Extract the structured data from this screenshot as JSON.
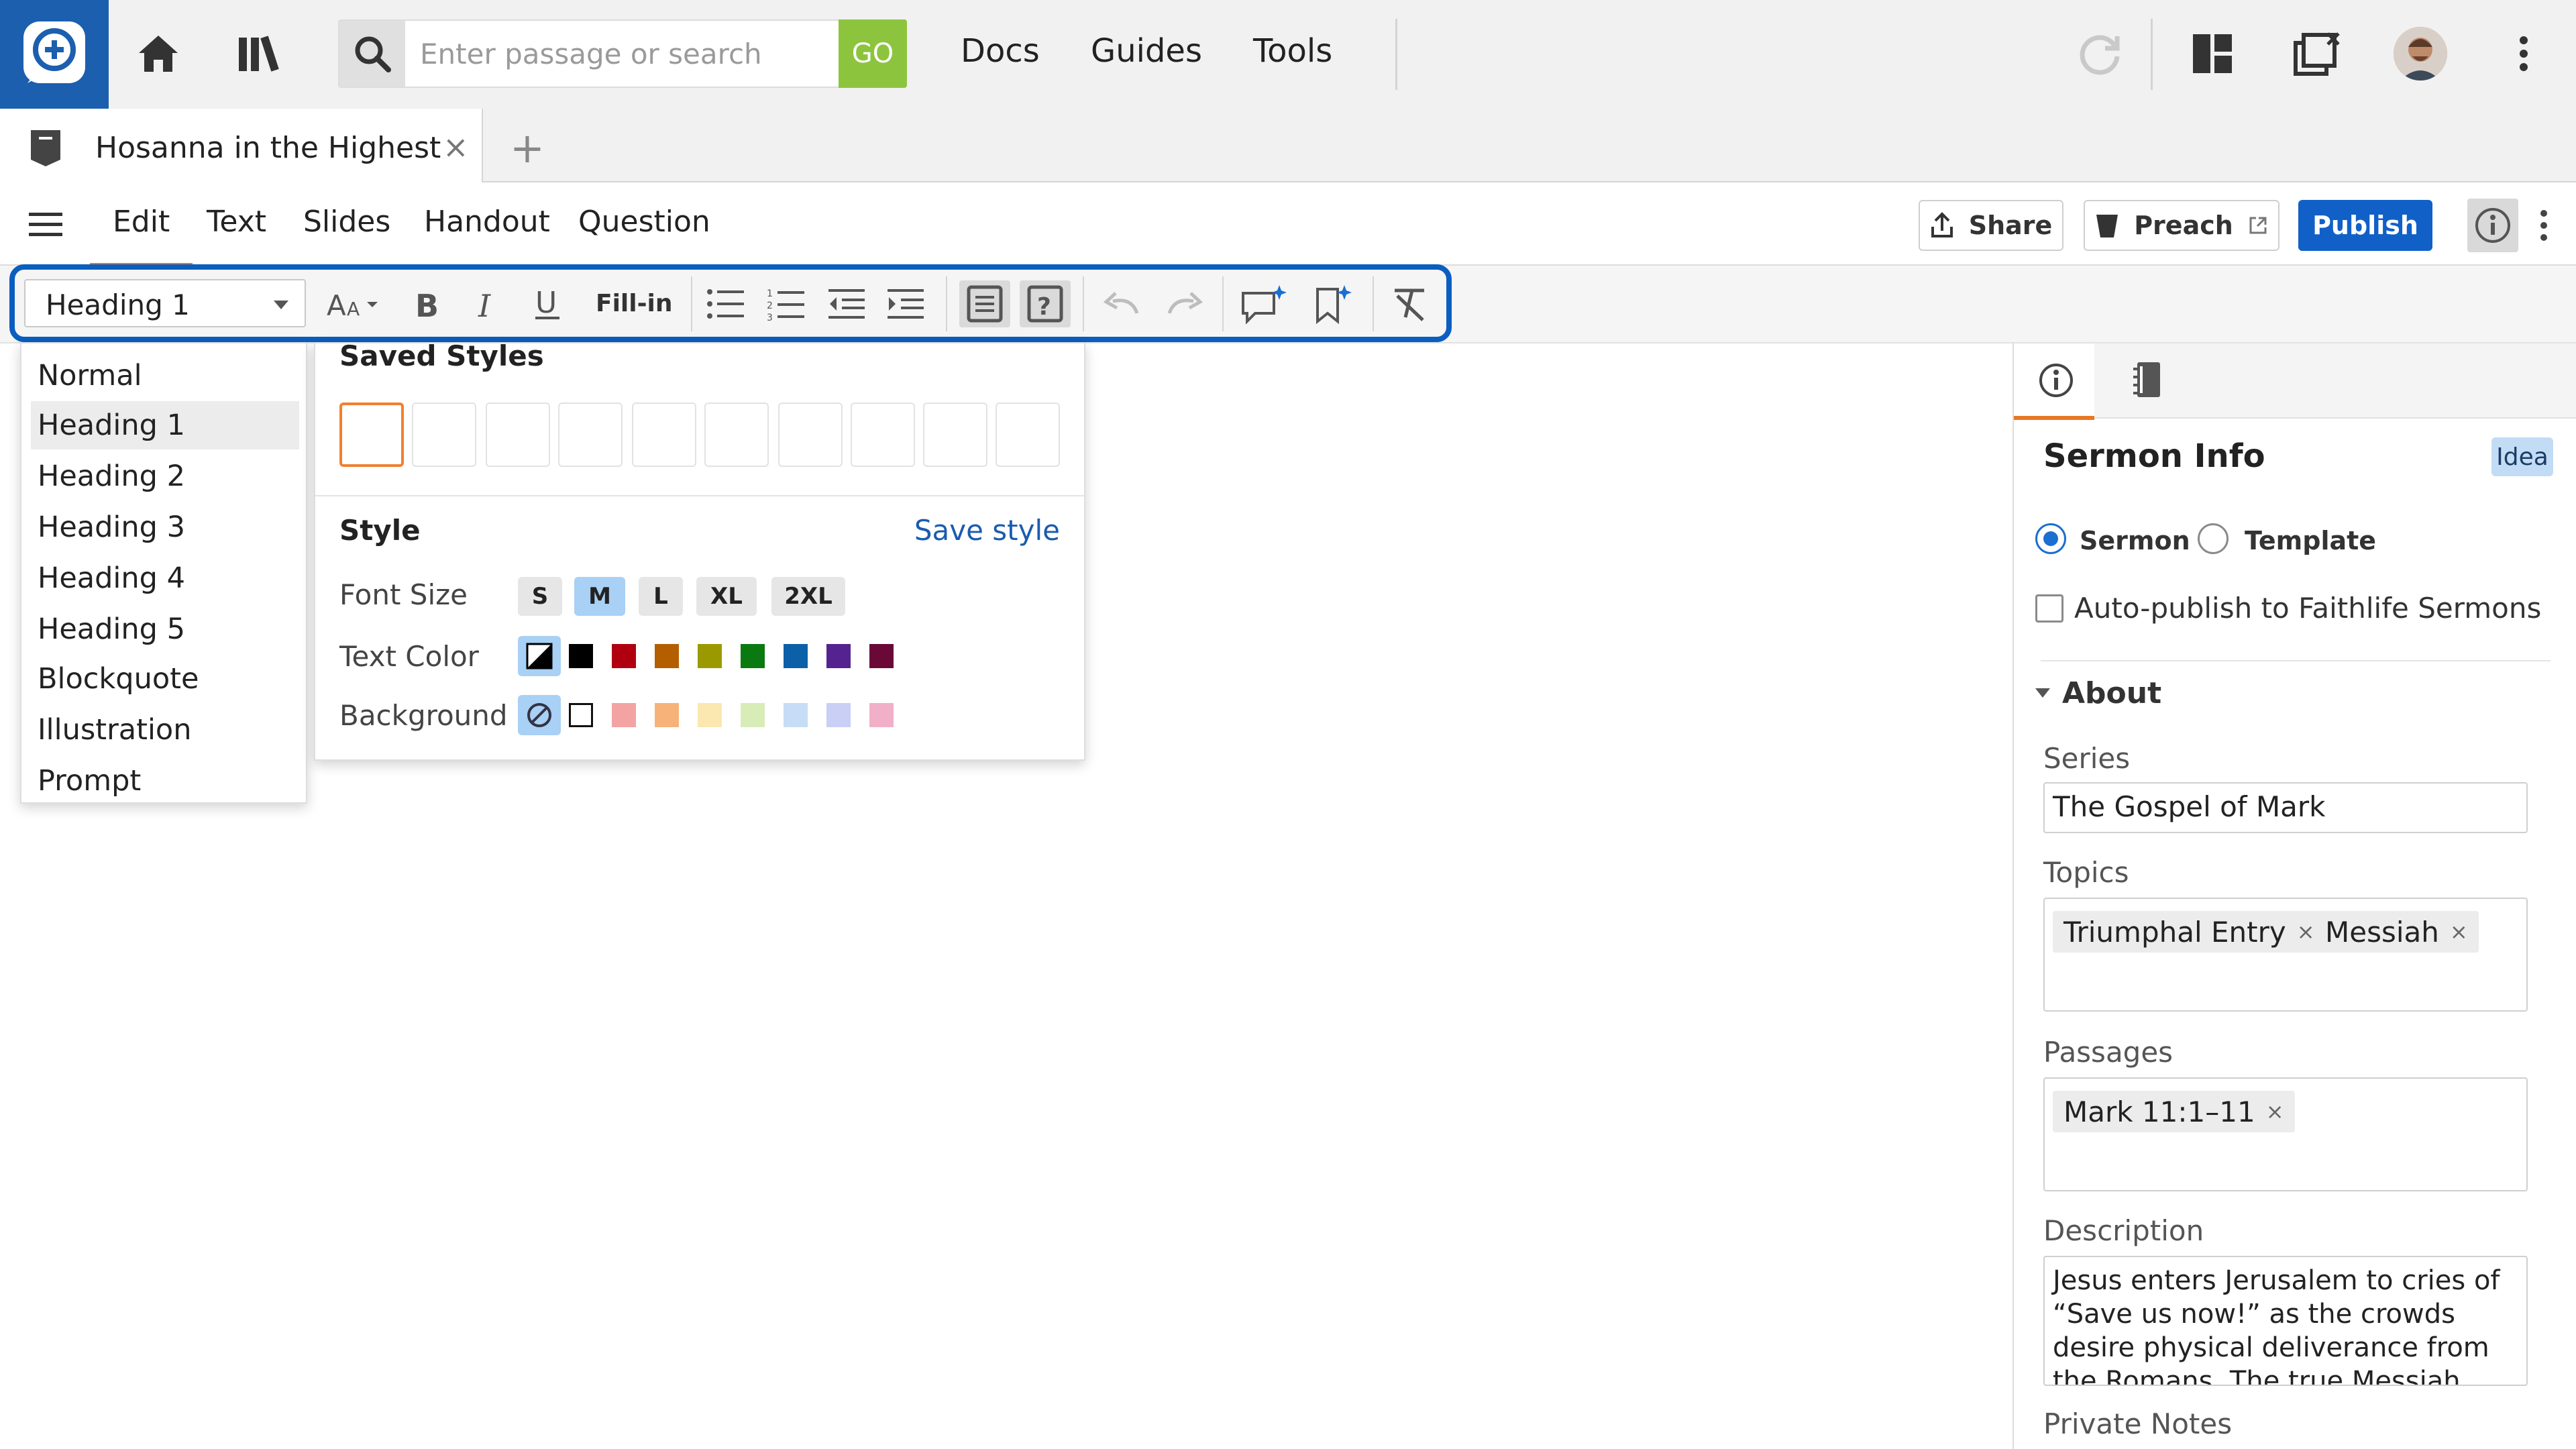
{
  "topbar": {
    "search_placeholder": "Enter passage or search",
    "go_label": "GO",
    "nav": [
      "Docs",
      "Guides",
      "Tools"
    ]
  },
  "tabs": {
    "doc_title": "Hosanna in the Highest",
    "close_glyph": "×",
    "new_glyph": "+"
  },
  "modes": {
    "items": [
      "Edit",
      "Text",
      "Slides",
      "Handout",
      "Question"
    ],
    "active": "Edit",
    "share_label": "Share",
    "preach_label": "Preach",
    "publish_label": "Publish"
  },
  "toolbar": {
    "style_value": "Heading 1",
    "fillin_label": "Fill-in"
  },
  "style_menu": {
    "items": [
      "Normal",
      "Heading 1",
      "Heading 2",
      "Heading 3",
      "Heading 4",
      "Heading 5",
      "Blockquote",
      "Illustration",
      "Prompt"
    ],
    "selected": "Heading 1"
  },
  "style_panel": {
    "saved_styles_label": "Saved Styles",
    "style_label": "Style",
    "save_style_label": "Save style",
    "font_size_label": "Font Size",
    "text_color_label": "Text Color",
    "background_label": "Background",
    "sizes": [
      "S",
      "M",
      "L",
      "XL",
      "2XL"
    ],
    "active_size": "M",
    "text_colors": [
      "#000000",
      "#b00010",
      "#b35f00",
      "#9a9a00",
      "#0a7a10",
      "#0b60a8",
      "#55238f",
      "#6a0838"
    ],
    "background_colors": [
      "#ffffff",
      "#f4a3a3",
      "#f7b27a",
      "#fbe8b0",
      "#d8ecb8",
      "#c6ddf5",
      "#c9cff5",
      "#f2b0c8"
    ]
  },
  "right_panel": {
    "title": "Sermon Info",
    "badge": "Idea",
    "radio_sermon": "Sermon",
    "radio_template": "Template",
    "autopublish_label": "Auto-publish to Faithlife Sermons",
    "about_label": "About",
    "series_label": "Series",
    "series_value": "The Gospel of Mark",
    "topics_label": "Topics",
    "topics": [
      "Triumphal Entry",
      "Messiah"
    ],
    "passages_label": "Passages",
    "passages": [
      "Mark 11:1–11"
    ],
    "description_label": "Description",
    "description_value": "Jesus enters Jerusalem to cries of “Save us now!” as the crowds desire physical deliverance from the Romans. The true Messiah",
    "private_notes_label": "Private Notes",
    "chip_remove_glyph": "×"
  }
}
